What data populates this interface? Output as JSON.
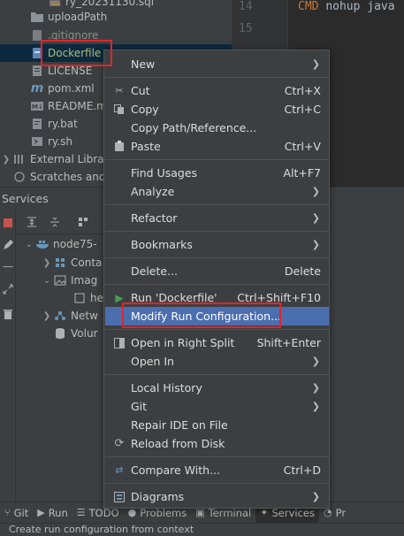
{
  "project_tree": {
    "items": [
      {
        "label": "ry_20231130.sql",
        "icon": "sql-file-icon"
      },
      {
        "label": "uploadPath",
        "icon": "folder-icon"
      },
      {
        "label": ".gitignore",
        "icon": "gitignore-file-icon"
      },
      {
        "label": "Dockerfile",
        "icon": "dockerfile-icon"
      },
      {
        "label": "LICENSE",
        "icon": "text-file-icon"
      },
      {
        "label": "pom.xml",
        "icon": "maven-file-icon"
      },
      {
        "label": "README.m",
        "icon": "markdown-file-icon"
      },
      {
        "label": "ry.bat",
        "icon": "bat-file-icon"
      },
      {
        "label": "ry.sh",
        "icon": "shell-file-icon"
      },
      {
        "label": "External Libra",
        "icon": "library-icon"
      },
      {
        "label": "Scratches and",
        "icon": "scratches-icon"
      }
    ]
  },
  "editor": {
    "lines": [
      {
        "num": "14",
        "keyword": "CMD",
        "text": "nohup java"
      },
      {
        "num": "15",
        "keyword": "",
        "text": ""
      }
    ]
  },
  "services": {
    "title": "Services",
    "tree": [
      {
        "label": "node75-",
        "icon": "docker-icon"
      },
      {
        "label": "Conta",
        "icon": "containers-icon"
      },
      {
        "label": "Imag",
        "icon": "images-icon"
      },
      {
        "label": "he",
        "icon": "image-icon"
      },
      {
        "label": "Netw",
        "icon": "networks-icon"
      },
      {
        "label": "Volur",
        "icon": "volumes-icon"
      }
    ]
  },
  "context_menu": {
    "items": [
      {
        "label": "New",
        "shortcut": "",
        "submenu": true,
        "icon": ""
      },
      {
        "label": "Cut",
        "shortcut": "Ctrl+X",
        "submenu": false,
        "icon": "cut-icon"
      },
      {
        "label": "Copy",
        "shortcut": "Ctrl+C",
        "submenu": false,
        "icon": "copy-icon"
      },
      {
        "label": "Copy Path/Reference...",
        "shortcut": "",
        "submenu": false,
        "icon": ""
      },
      {
        "label": "Paste",
        "shortcut": "Ctrl+V",
        "submenu": false,
        "icon": "paste-icon"
      },
      {
        "label": "Find Usages",
        "shortcut": "Alt+F7",
        "submenu": false,
        "icon": ""
      },
      {
        "label": "Analyze",
        "shortcut": "",
        "submenu": true,
        "icon": ""
      },
      {
        "label": "Refactor",
        "shortcut": "",
        "submenu": true,
        "icon": ""
      },
      {
        "label": "Bookmarks",
        "shortcut": "",
        "submenu": true,
        "icon": ""
      },
      {
        "label": "Delete...",
        "shortcut": "Delete",
        "submenu": false,
        "icon": ""
      },
      {
        "label": "Run 'Dockerfile'",
        "shortcut": "Ctrl+Shift+F10",
        "submenu": false,
        "icon": "run-icon"
      },
      {
        "label": "Modify Run Configuration...",
        "shortcut": "",
        "submenu": false,
        "icon": "",
        "highlighted": true
      },
      {
        "label": "Open in Right Split",
        "shortcut": "Shift+Enter",
        "submenu": false,
        "icon": "split-icon"
      },
      {
        "label": "Open In",
        "shortcut": "",
        "submenu": true,
        "icon": ""
      },
      {
        "label": "Local History",
        "shortcut": "",
        "submenu": true,
        "icon": ""
      },
      {
        "label": "Git",
        "shortcut": "",
        "submenu": true,
        "icon": ""
      },
      {
        "label": "Repair IDE on File",
        "shortcut": "",
        "submenu": false,
        "icon": ""
      },
      {
        "label": "Reload from Disk",
        "shortcut": "",
        "submenu": false,
        "icon": "reload-icon"
      },
      {
        "label": "Compare With...",
        "shortcut": "Ctrl+D",
        "submenu": false,
        "icon": "compare-icon"
      },
      {
        "label": "Diagrams",
        "shortcut": "",
        "submenu": true,
        "icon": "diagrams-icon"
      }
    ]
  },
  "bottom_toolbar": {
    "tabs": [
      {
        "label": "Git",
        "icon": "git-icon"
      },
      {
        "label": "Run",
        "icon": "run-icon"
      },
      {
        "label": "TODO",
        "icon": "todo-icon"
      },
      {
        "label": "Problems",
        "icon": "problems-icon"
      },
      {
        "label": "Terminal",
        "icon": "terminal-icon"
      },
      {
        "label": "Services",
        "icon": "services-icon",
        "active": true
      },
      {
        "label": "Pr",
        "icon": "profiler-icon"
      }
    ]
  },
  "status_bar": {
    "text": "Create run configuration from context"
  },
  "colors": {
    "selection": "#4b6eaf",
    "panel": "#3c3f41",
    "editor": "#2b2b2b",
    "annotation": "#e0252b"
  }
}
